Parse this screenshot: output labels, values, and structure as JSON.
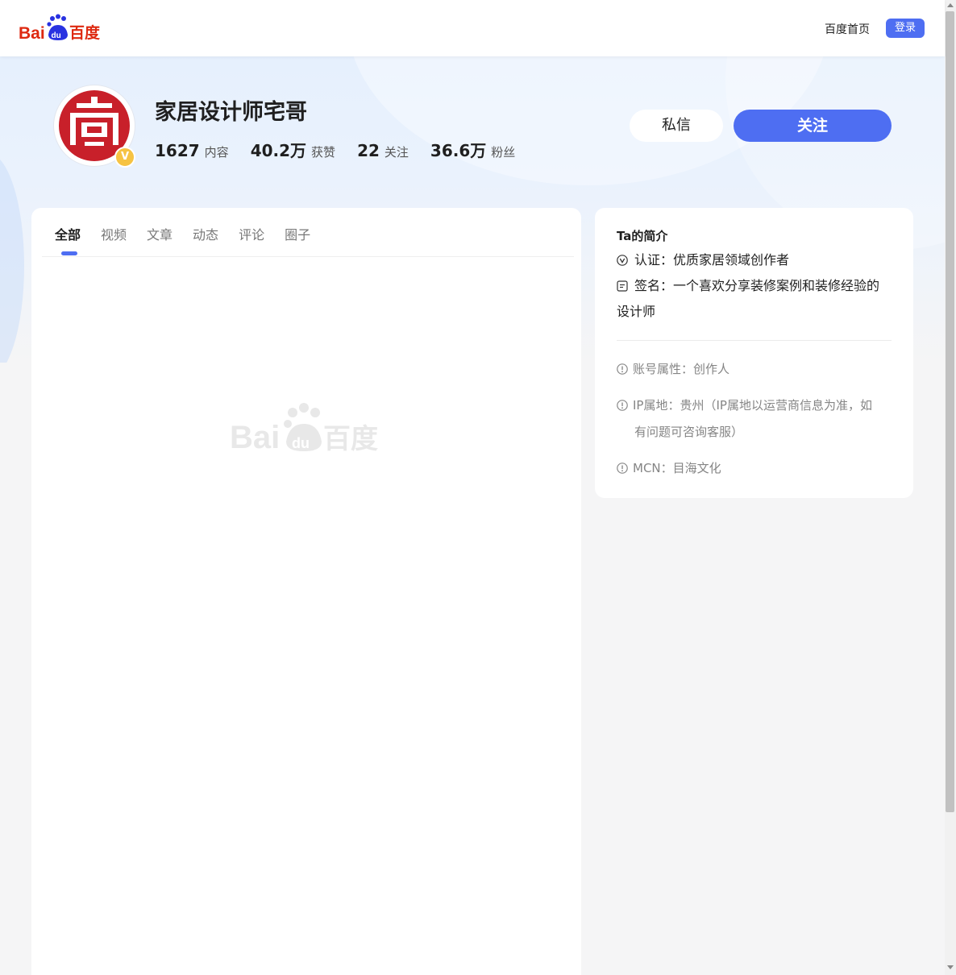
{
  "header": {
    "logo_alt": "Baidu百度",
    "home_link": "百度首页",
    "login_button": "登录"
  },
  "profile": {
    "name": "家居设计师宅哥",
    "verified_badge": "V",
    "stats": [
      {
        "value": "1627",
        "label": "内容"
      },
      {
        "value": "40.2万",
        "label": "获赞"
      },
      {
        "value": "22",
        "label": "关注"
      },
      {
        "value": "36.6万",
        "label": "粉丝"
      }
    ],
    "message_button": "私信",
    "follow_button": "关注"
  },
  "tabs": [
    {
      "label": "全部",
      "active": true
    },
    {
      "label": "视频",
      "active": false
    },
    {
      "label": "文章",
      "active": false
    },
    {
      "label": "动态",
      "active": false
    },
    {
      "label": "评论",
      "active": false
    },
    {
      "label": "圈子",
      "active": false
    }
  ],
  "intro": {
    "title": "Ta的简介",
    "certification": "认证：优质家居领域创作者",
    "signature_line1": "签名：一个喜欢分享装修案例和装修经验的",
    "signature_line2": "设计师",
    "account_type": "账号属性：创作人",
    "ip_line1": "IP属地：贵州（IP属地以运营商信息为准，如",
    "ip_line2": "有问题可咨询客服）",
    "mcn": "MCN：目海文化"
  },
  "colors": {
    "accent": "#4e6ef2",
    "brand_red": "#de2910",
    "brand_blue": "#2932e1",
    "avatar_red": "#c8202a",
    "badge_gold": "#f6c343"
  }
}
